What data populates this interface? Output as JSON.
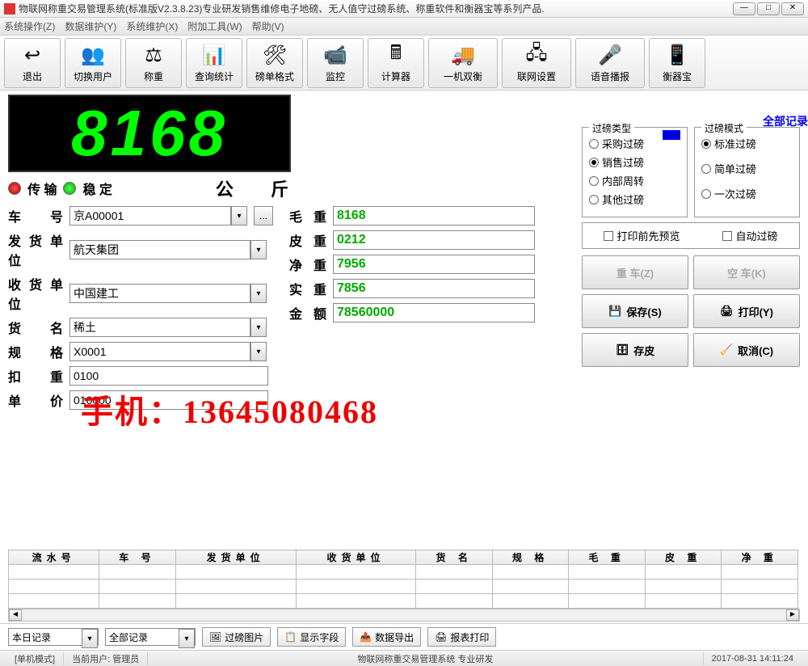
{
  "title": "物联网称重交易管理系统(标准版V2.3.8.23)专业研发销售维修电子地磅、无人值守过磅系统、称重软件和衡器宝等系列产品.",
  "menu": [
    "系统操作(Z)",
    "数据维护(Y)",
    "系统维护(X)",
    "附加工具(W)",
    "帮助(V)"
  ],
  "toolbar": {
    "exit": "退出",
    "switch_user": "切换用户",
    "weigh": "称重",
    "query": "查询统计",
    "format": "磅单格式",
    "monitor": "监控",
    "calc": "计算器",
    "dual": "一机双衡",
    "network": "联网设置",
    "voice": "语音播报",
    "hqb": "衡器宝"
  },
  "display_value": "8168",
  "all_records": "全部记录",
  "status": {
    "transmit": "传 输",
    "stable": "稳 定"
  },
  "unit": "公   斤",
  "form": {
    "car_no_label": "车   号",
    "car_no": "京A00001",
    "sender_label": "发货单位",
    "sender": "航天集团",
    "receiver_label": "收货单位",
    "receiver": "中国建工",
    "goods_label": "货   名",
    "goods": "稀土",
    "spec_label": "规   格",
    "spec": "X0001",
    "deduct_label": "扣   重",
    "deduct": "0100",
    "price_label": "单   价",
    "price": "010000",
    "gross_label": "毛   重",
    "gross": "8168",
    "tare_label": "皮   重",
    "tare": "0212",
    "net_label": "净   重",
    "net": "7956",
    "actual_label": "实   重",
    "actual": "7856",
    "amount_label": "金   额",
    "amount": "78560000"
  },
  "weigh_type": {
    "title": "过磅类型",
    "opts": [
      "采购过磅",
      "销售过磅",
      "内部周转",
      "其他过磅"
    ],
    "selected": 1
  },
  "weigh_mode": {
    "title": "过磅模式",
    "opts": [
      "标准过磅",
      "简单过磅",
      "一次过磅"
    ],
    "selected": 0
  },
  "checks": {
    "preview": "打印前先预览",
    "auto": "自动过磅"
  },
  "buttons": {
    "heavy": "重 车(Z)",
    "empty": "空 车(K)",
    "save": "保存(S)",
    "print": "打印(Y)",
    "tare": "存皮",
    "cancel": "取消(C)"
  },
  "watermark": "手机：13645080468",
  "grid_headers": [
    "流水号",
    "车   号",
    "发货单位",
    "收货单位",
    "货   名",
    "规   格",
    "毛   重",
    "皮   重",
    "净   重"
  ],
  "bottom": {
    "today": "本日记录",
    "all": "全部记录",
    "img": "过磅图片",
    "fields": "显示字段",
    "export": "数据导出",
    "report": "报表打印"
  },
  "statusbar": {
    "mode": "[单机模式]",
    "user": "当前用户: 管理员",
    "system": "物联网称重交易管理系统  专业研发",
    "time": "2017-08-31 14:11:24"
  }
}
